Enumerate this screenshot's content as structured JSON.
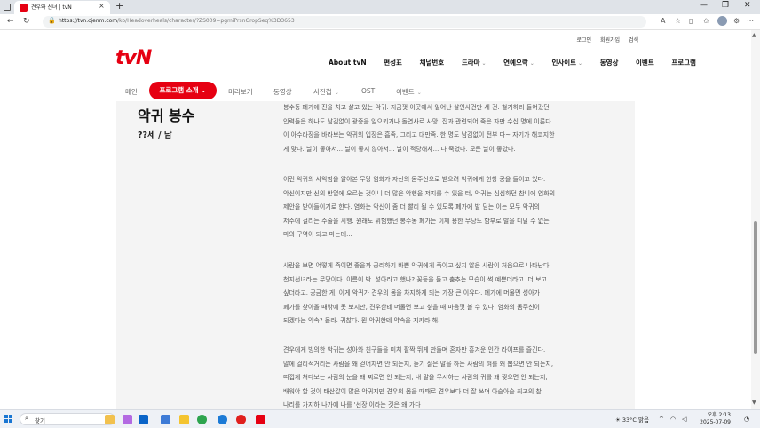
{
  "browser": {
    "tab_title": "견우와 선녀 | tvN",
    "tab_close": "×",
    "new_tab": "+",
    "url_host": "https://tvn.cjenm.com",
    "url_path": "/ko/Headoverheals/character/?ZS009=pgmiPrsnGropSeq%3D3653",
    "window_controls": [
      "—",
      "❐",
      "✕"
    ],
    "icons": [
      "back-icon",
      "refresh-icon",
      "lock-icon",
      "read-aloud-icon",
      "favorite-icon",
      "split-icon",
      "favorites-bar-icon",
      "extensions-icon",
      "more-icon"
    ]
  },
  "site": {
    "logo": "tvN",
    "util_links": [
      "로그인",
      "회원가입",
      "검색"
    ],
    "main_nav": [
      "About tvN",
      "편성표",
      "채널번호",
      "드라마",
      "연예오락",
      "인사이트",
      "동영상",
      "이벤트",
      "프로그램"
    ],
    "sub_nav": {
      "items": [
        "메인",
        "미리보기",
        "동영상",
        "사진첩",
        "OST",
        "이벤트"
      ],
      "active": "프로그램 소개"
    }
  },
  "character": {
    "name": "악귀 봉수",
    "info": "??세 / 남"
  },
  "paragraphs": [
    [
      "봉수동 폐가에 진을 치고 살고 있는 악귀. 지금껏 이곳에서 일어난 살인사건만 세 건. 철거하러 들어갔던",
      "인력들은 하나도 남김없이 광증을 일으키거나 돌연사로 사망. 집과 관련되어 죽은 자만 수십 명에 이른다.",
      "이 아수라장을 바라보는 악귀의 입장은 흡족, 그리고 대만족. 한 명도 남김없이 전부 다~ 자기가 해코지한",
      "게 맞다. 날이 좋아서... 날이 좋지 않아서... 날이 적당해서... 다 죽였다. 모든 날이 좋았다."
    ],
    [
      "이런 악귀의 사악함을 알아본 무당 염화가 자신의 몸주신으로 받으려 악귀에게 한창 공을 들이고 있다.",
      "악신이지만 신의 반열에 오르는 것이니 더 많은 악행을 저지를 수 있을 터, 악귀는 심심하던 참니에 염화의",
      "제안을 받아들이기로 한다. 염화는 악신이 좀 더 빨리 될 수 있도록 폐가에 발 딛는 이는 모두 악귀의",
      "저주에 걸리는 주술을 시행. 원래도 위험했던 봉수동 폐가는 이제 용한 무당도 함부로 발을 디딜 수 없는",
      "마의 구역이 되고 마는데..."
    ],
    [
      "사람을 보면 어떻게 죽이면 좋을까 궁리하기 바쁜 악귀에게 죽이고 싶지 않은 사람이 처음으로 나타난다.",
      "천지선녀라는 무당이다. 이름이 박..성아라고 했나? 꽃등을 들고 춤추는 모습이 썩 예쁜더라고. 더 보고",
      "싶더라고. 궁금한 게, 이게 악귀가 견우의 몸을 차지하게 되는 가장 큰 이유다. 폐가에 머물면 성아가",
      "폐가를 찾아올 때밖에 못 보지만, 견우한테 머물면 보고 싶을 때 마음껏 볼 수 있다. 염화의 몸주신이",
      "되겠다는 약속? 몰라. 귀찮다. 뭔 악귀한테 약속을 지키라 해."
    ],
    [
      "견우에게 빙의한 악귀는 성아와 친구들을 미쳐 팔짝 뛰게 만들며 혼자만 흥겨운 인간 라이프를 즐긴다.",
      "말에 걸리적거리는 사람을 왜 걷어차면 안 되는지, 듣기 싫은 말을 하는 사람의 혀를 왜 뽑으면 안 되는지,",
      "띠껍게 쳐다보는 사람의 눈을 왜 찌르면 안 되는지, 내 말을 무시하는 사람의 귀를 왜 찢으면 안 되는지,",
      "배워야 할 것이 태산같이 많은 악귀지만 견우의 몸을 때때로 견우보다 더 잘 쓰며 아슬아슬 최고의 찰",
      "나리를 가지하 나가에 나를 '선장'이라는 것은 왜 가다"
    ]
  ],
  "taskbar": {
    "search_placeholder": "찾기",
    "weather_temp": "33°C",
    "weather_desc": "맑음",
    "time": "오후 2:13",
    "date": "2025-07-09"
  }
}
